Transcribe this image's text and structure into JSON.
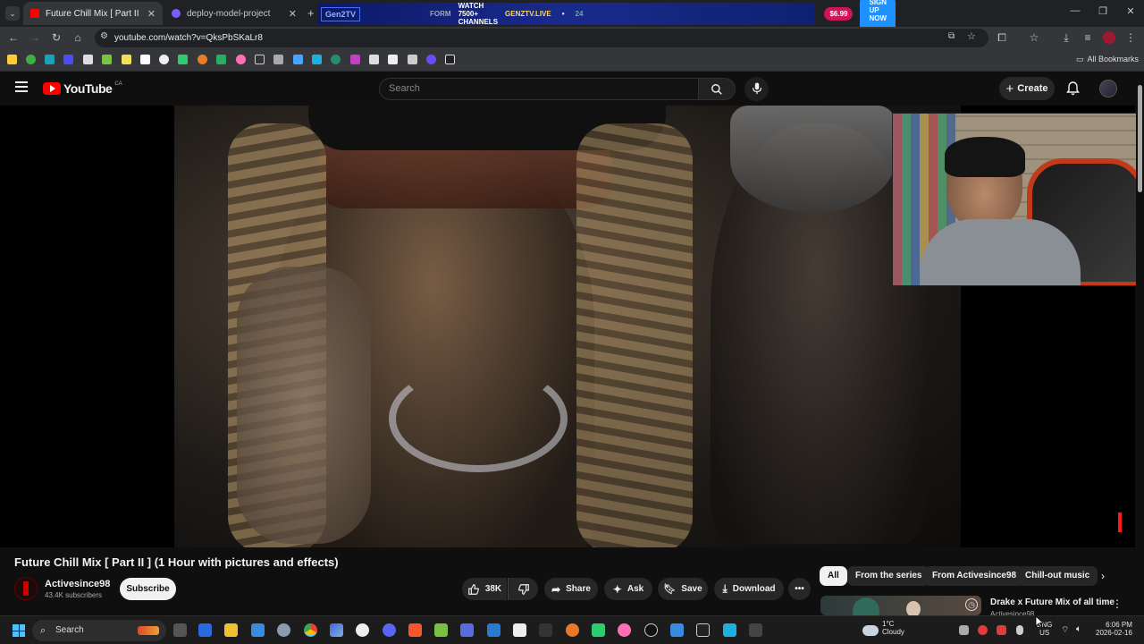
{
  "browser": {
    "tabs": [
      {
        "title": "Future Chill Mix [ Part II ] (1 Hou",
        "active": true,
        "favicon_color": "#ff0000"
      },
      {
        "title": "deploy-model-project",
        "active": false,
        "favicon_color": "#7b5cff"
      }
    ],
    "new_tab_icon": "plus-icon",
    "url": "youtube.com/watch?v=QksPbSKaLr8",
    "all_bookmarks": "All Bookmarks",
    "ad_banner": {
      "brand": "Gen2TV",
      "segment": "FORM",
      "headline": "WATCH 7500+ CHANNELS",
      "site": "GENZTV.LIVE",
      "dot": "•",
      "number": "24",
      "price": "$6.99",
      "cta": "SIGN UP NOW →"
    }
  },
  "youtube": {
    "logo_text": "YouTube",
    "country": "CA",
    "search_placeholder": "Search",
    "create_label": "Create",
    "video_title": "Future Chill Mix [ Part II ] (1 Hour with pictures and effects)",
    "channel": {
      "name": "Activesince98",
      "subscribers": "43.4K subscribers",
      "subscribe_label": "Subscribe"
    },
    "actions": {
      "likes": "38K",
      "share": "Share",
      "ask": "Ask",
      "save": "Save",
      "download": "Download"
    },
    "chips": [
      "All",
      "From the series",
      "From Activesince98",
      "Chill-out music"
    ],
    "recommended": {
      "title": "Drake x Future Mix of all time",
      "channel": "Activesince98"
    }
  },
  "taskbar": {
    "search_label": "Search",
    "weather_temp": "1°C",
    "weather_desc": "Cloudy",
    "lang_top": "ENG",
    "lang_bottom": "US",
    "time": "6:06 PM",
    "date": "2026-02-16"
  },
  "colors": {
    "yt_red": "#ff0000",
    "background": "#0f0f0f"
  }
}
